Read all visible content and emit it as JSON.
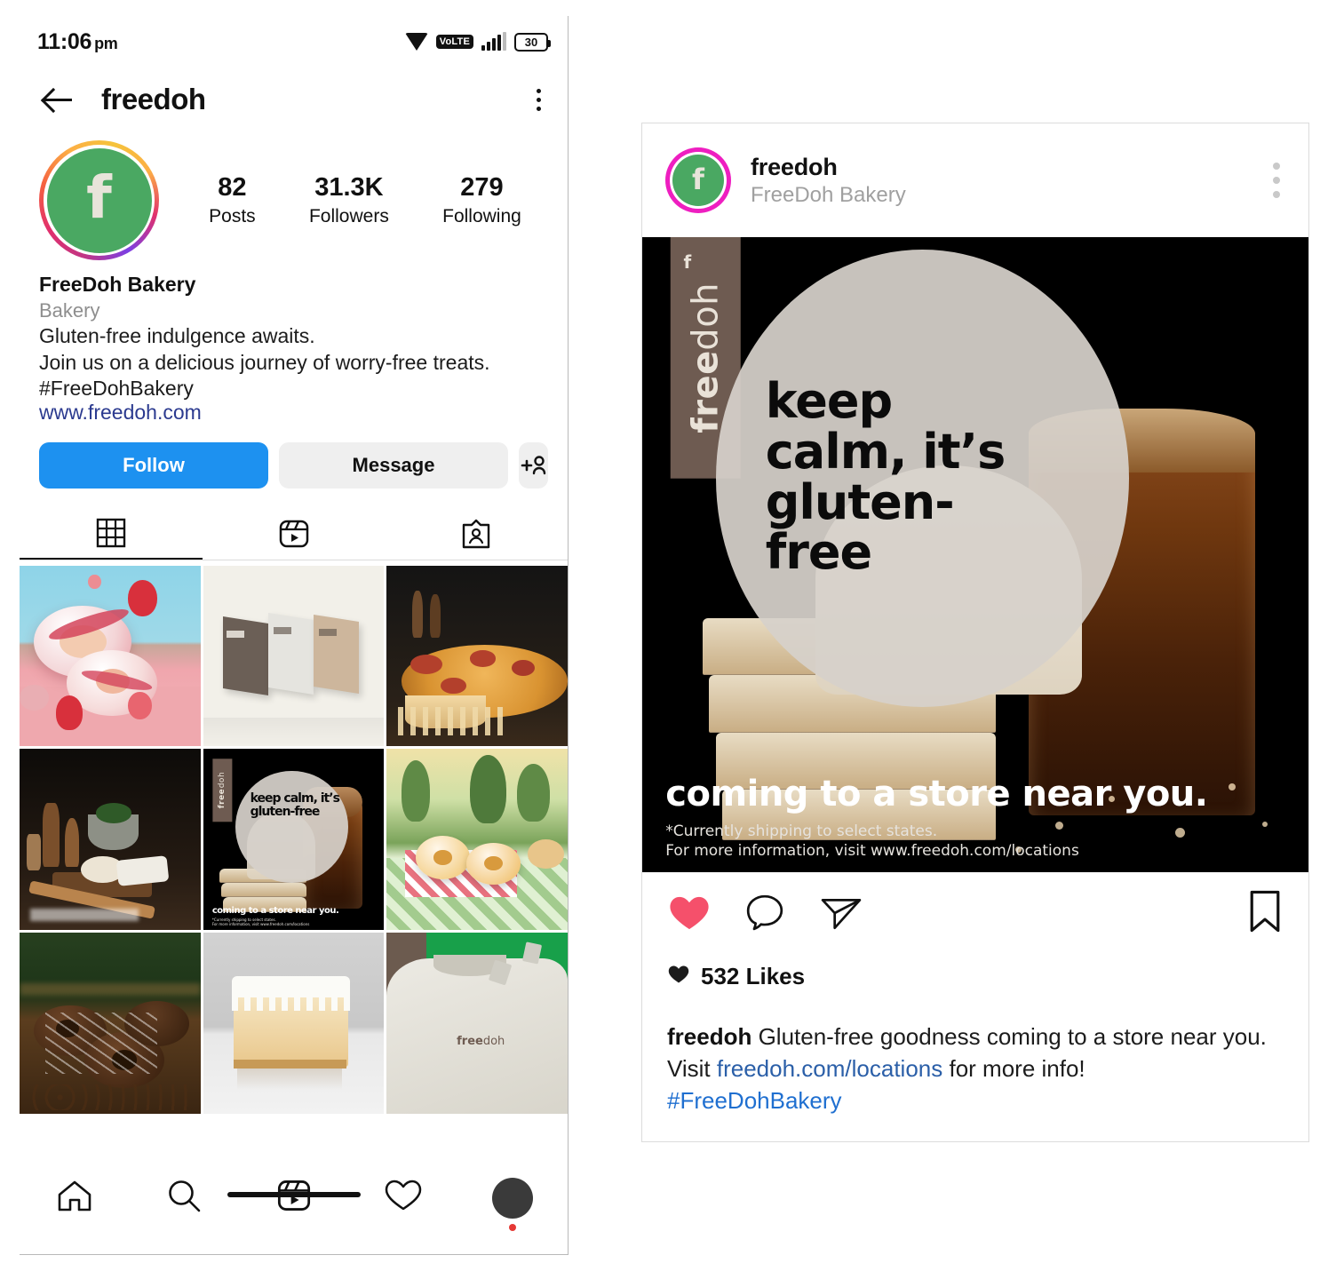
{
  "status_bar": {
    "time": "11:06",
    "ampm": "pm",
    "volte": "VoLTE",
    "battery": "30",
    "icons": [
      "wifi-icon",
      "volte-icon",
      "signal-bars-icon",
      "battery-icon"
    ]
  },
  "top_bar": {
    "back_icon": "back-arrow-icon",
    "title": "freedoh",
    "menu_icon": "kebab-menu-icon"
  },
  "profile": {
    "avatar_letter": "f",
    "avatar_bg": "#4aa862",
    "stats": [
      {
        "num": "82",
        "label": "Posts"
      },
      {
        "num": "31.3K",
        "label": "Followers"
      },
      {
        "num": "279",
        "label": "Following"
      }
    ],
    "name": "FreeDoh Bakery",
    "category": "Bakery",
    "bio_line_1": "Gluten-free indulgence awaits.",
    "bio_line_2": "Join us on a delicious journey of worry-free treats.",
    "hashtag": "#FreeDohBakery",
    "website": "www.freedoh.com"
  },
  "actions": {
    "follow_label": "Follow",
    "follow_color": "#1d91f0",
    "message_label": "Message",
    "adduser_icon": "add-person-icon"
  },
  "tabs": [
    {
      "name": "grid",
      "icon": "grid-icon",
      "active": true
    },
    {
      "name": "reels",
      "icon": "reels-icon",
      "active": false
    },
    {
      "name": "tagged",
      "icon": "tagged-icon",
      "active": false
    }
  ],
  "grid_posts": [
    {
      "alt": "strawberry-glazed-donuts-splash"
    },
    {
      "alt": "freedoh-product-boxes"
    },
    {
      "alt": "pepperoni-pizza-slice"
    },
    {
      "alt": "dough-preparation-rolling-pin"
    },
    {
      "alt": "keep-calm-gluten-free-bread-ad"
    },
    {
      "alt": "glazed-donuts-picnic-blanket"
    },
    {
      "alt": "chocolate-sprinkle-donuts"
    },
    {
      "alt": "frosted-cake-slice"
    },
    {
      "alt": "freedoh-branded-tshirts"
    }
  ],
  "bottom_nav": [
    {
      "name": "home",
      "icon": "home-icon"
    },
    {
      "name": "search",
      "icon": "search-icon"
    },
    {
      "name": "reels",
      "icon": "reels-icon"
    },
    {
      "name": "activity",
      "icon": "heart-icon"
    },
    {
      "name": "profile",
      "icon": "profile-avatar-icon",
      "badge": true
    }
  ],
  "post": {
    "username": "freedoh",
    "subtitle": "FreeDoh Bakery",
    "menu_icon": "kebab-menu-icon",
    "ring_color": "#ee1ec0",
    "creative": {
      "brand_bold": "free",
      "brand_thin": "doh",
      "brand_mark": "f",
      "headline": "keep calm, it’s gluten-free",
      "cta": "coming to a store near you.",
      "fineprint_1": "*Currently shipping to select states.",
      "fineprint_2": "For more information, visit www.freedoh.com/locations"
    },
    "actions": {
      "like_icon": "heart-filled-icon",
      "like_color": "#f5506b",
      "comment_icon": "comment-icon",
      "share_icon": "share-paper-plane-icon",
      "save_icon": "bookmark-icon"
    },
    "likes_text": "532 Likes",
    "caption_user": "freedoh",
    "caption_text_1": " Gluten-free goodness coming to a store near ",
    "caption_text_2": "you. Visit ",
    "caption_link": "freedoh.com/locations",
    "caption_text_3": " for more info!",
    "caption_hashtag": "#FreeDohBakery"
  }
}
